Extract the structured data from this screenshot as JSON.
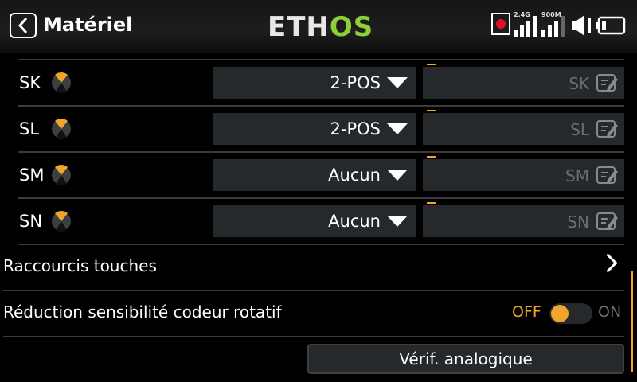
{
  "header": {
    "title": "Matériel",
    "logo_left": "ETH",
    "logo_right": "OS",
    "signal_24": "2.4G",
    "signal_900": "900M"
  },
  "switches": [
    {
      "name": "SK",
      "type": "2-POS",
      "label": "SK"
    },
    {
      "name": "SL",
      "type": "2-POS",
      "label": "SL"
    },
    {
      "name": "SM",
      "type": "Aucun",
      "label": "SM"
    },
    {
      "name": "SN",
      "type": "Aucun",
      "label": "SN"
    }
  ],
  "settings": {
    "shortcuts_label": "Raccourcis touches",
    "encoder_label": "Réduction sensibilité codeur rotatif",
    "encoder_off": "OFF",
    "encoder_on": "ON",
    "encoder_state": "OFF"
  },
  "analog_button": "Vérif. analogique",
  "colors": {
    "accent": "#f2a42b",
    "logo_green": "#8ccf3a",
    "field_bg": "#25292b"
  }
}
